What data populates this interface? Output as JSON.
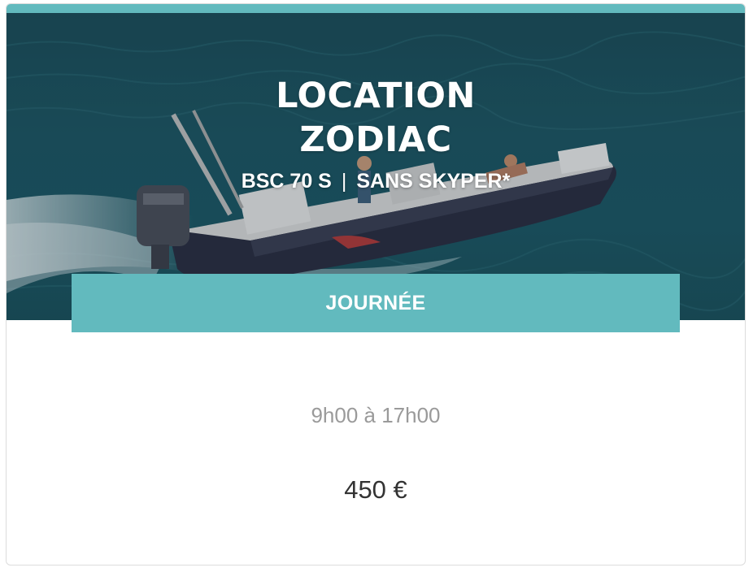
{
  "card": {
    "title_line1": "LOCATION",
    "title_line2": "ZODIAC",
    "model": "BSC 70 S",
    "separator": "|",
    "option": "SANS SKYPER*",
    "period": "JOURNÉE",
    "hours": "9h00 à 17h00",
    "price": "450 €"
  },
  "colors": {
    "accent": "#62babe",
    "hours_text": "#9a9a9a",
    "price_text": "#333333"
  }
}
